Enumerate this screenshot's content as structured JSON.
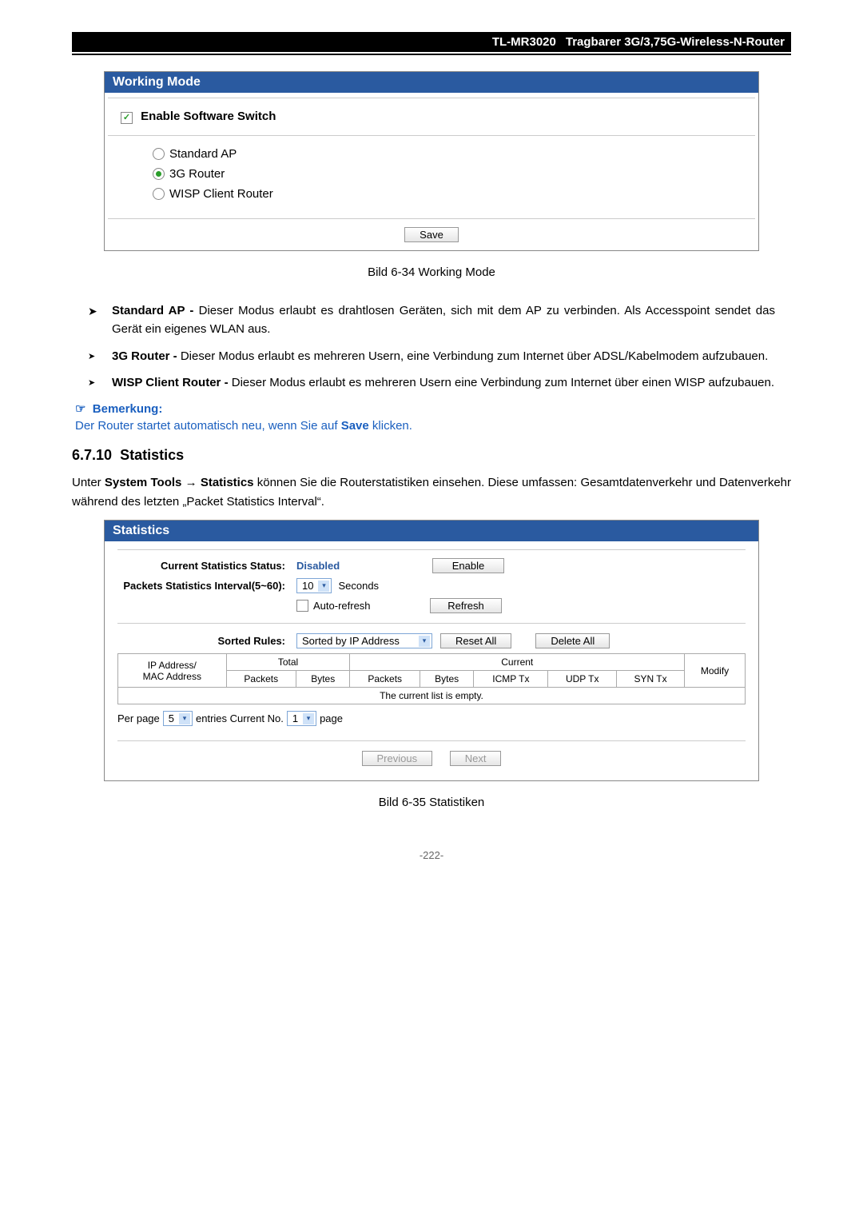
{
  "header": {
    "model": "TL-MR3020",
    "desc": "Tragbarer 3G/3,75G-Wireless-N-Router"
  },
  "wm": {
    "title": "Working Mode",
    "enable_label": "Enable Software Switch",
    "opt1": "Standard AP",
    "opt2": "3G Router",
    "opt3": "WISP Client Router",
    "save": "Save",
    "caption": "Bild 6-34 Working Mode"
  },
  "b1": {
    "bold": "Standard AP - ",
    "text": "Dieser Modus erlaubt es drahtlosen Geräten, sich mit dem AP zu verbinden. Als Accesspoint sendet das Gerät ein eigenes WLAN aus."
  },
  "b2": {
    "bold": "3G Router - ",
    "text": "Dieser Modus erlaubt es mehreren Usern, eine Verbindung zum Internet über ADSL/Kabelmodem aufzubauen."
  },
  "b3": {
    "bold": "WISP Client Router - ",
    "text": "Dieser Modus erlaubt es mehreren Usern eine Verbindung zum Internet über einen WISP aufzubauen."
  },
  "note": {
    "hdr": "Bemerkung:",
    "p1": "Der Router startet automatisch neu, wenn Sie auf ",
    "p2": "Save",
    "p3": " klicken."
  },
  "sec": {
    "num": "6.7.10",
    "title": "Statistics"
  },
  "intro": {
    "p1": "Unter ",
    "p2": "System Tools",
    "p3": " → ",
    "p4": "Statistics",
    "p5": " können Sie die Routerstatistiken einsehen. Diese umfassen: Gesamtdatenverkehr und Datenverkehr während des letzten „Packet Statistics Interval“."
  },
  "st": {
    "title": "Statistics",
    "l1": "Current Statistics Status:",
    "v1": "Disabled",
    "btn_enable": "Enable",
    "l2": "Packets Statistics Interval(5~60):",
    "v2": "10",
    "seconds": "Seconds",
    "auto": "Auto-refresh",
    "btn_refresh": "Refresh",
    "sorted_lbl": "Sorted Rules:",
    "sorted_val": "Sorted by IP Address",
    "btn_reset": "Reset All",
    "btn_delete": "Delete All",
    "th": {
      "ip": "IP Address/\nMAC Address",
      "total": "Total",
      "current": "Current",
      "packets": "Packets",
      "bytes": "Bytes",
      "icmp": "ICMP Tx",
      "udp": "UDP Tx",
      "syn": "SYN Tx",
      "modify": "Modify"
    },
    "empty": "The current list is empty.",
    "perpage_a": "Per page",
    "perpage_v": "5",
    "entries": "entries  Current No.",
    "curno": "1",
    "page": "page",
    "prev": "Previous",
    "next": "Next",
    "caption": "Bild 6-35 Statistiken"
  },
  "pagenum": "-222-"
}
